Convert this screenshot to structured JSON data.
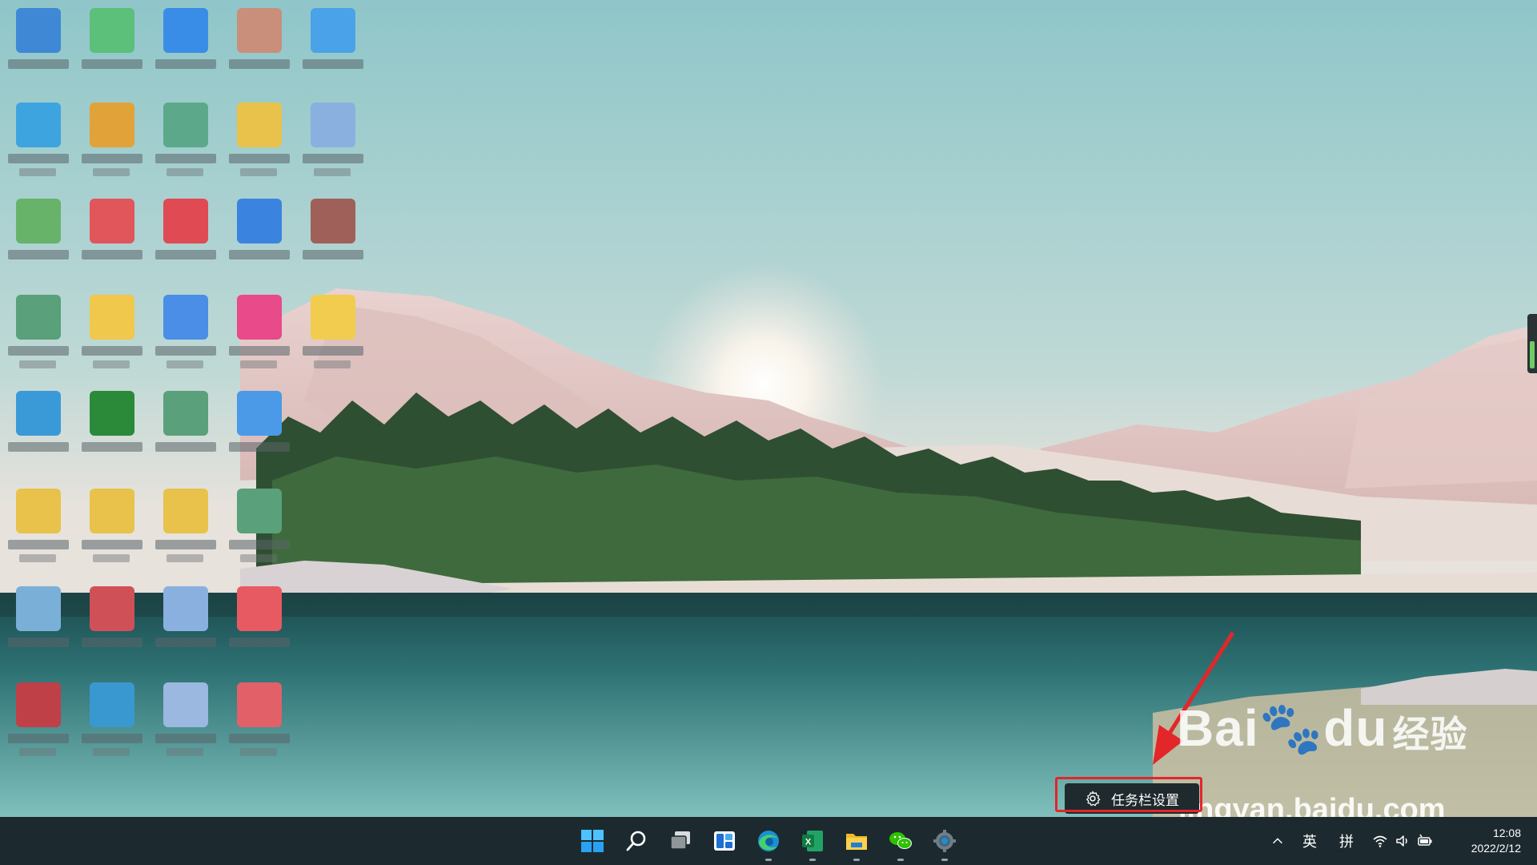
{
  "desktop": {
    "icons": [
      {
        "color": "#3f88d6"
      },
      {
        "color": "#5cbf7a"
      },
      {
        "color": "#3a8de6"
      },
      {
        "color": "#c98f7a"
      },
      {
        "color": "#4aa3e8"
      },
      {
        "color": "#3ea4e0"
      },
      {
        "color": "#e2a23a"
      },
      {
        "color": "#5ba98a"
      },
      {
        "color": "#e8c24a"
      },
      {
        "color": "#8ab0e0"
      },
      {
        "color": "#67b36a"
      },
      {
        "color": "#e0565a"
      },
      {
        "color": "#e04a52"
      },
      {
        "color": "#3a84e0"
      },
      {
        "color": "#a0605a"
      },
      {
        "color": "#5aa07a"
      },
      {
        "color": "#f0c84c"
      },
      {
        "color": "#4a8ee8"
      },
      {
        "color": "#e84a8a"
      },
      {
        "color": "#f2cc4e"
      },
      {
        "color": "#3a9ad8"
      },
      {
        "color": "#2a8a3a"
      },
      {
        "color": "#5aa07a"
      },
      {
        "color": "#4a9ae8"
      },
      {
        "color": "#e8c24a"
      },
      {
        "color": "#e8c24a"
      },
      {
        "color": "#e8c24a"
      },
      {
        "color": "#5aa07a"
      },
      {
        "color": "#7ab0d8"
      },
      {
        "color": "#d05058"
      },
      {
        "color": "#8ab0e0"
      },
      {
        "color": "#e85a62"
      },
      {
        "color": "#c04048"
      },
      {
        "color": "#3a98d0"
      },
      {
        "color": "#9ab8e0"
      },
      {
        "color": "#e26068"
      }
    ]
  },
  "context_menu": {
    "label": "任务栏设置"
  },
  "watermark": {
    "brand": "Bai",
    "brand_suffix": "du",
    "jingyan": "经验",
    "url": "jingyan.baidu.com"
  },
  "taskbar": {
    "apps": [
      {
        "name": "start-button",
        "label": "Start"
      },
      {
        "name": "search-button",
        "label": "Search"
      },
      {
        "name": "task-view-button",
        "label": "Task View"
      },
      {
        "name": "widgets-button",
        "label": "Widgets"
      },
      {
        "name": "edge-button",
        "label": "Microsoft Edge"
      },
      {
        "name": "excel-button",
        "label": "Excel"
      },
      {
        "name": "file-explorer-button",
        "label": "File Explorer"
      },
      {
        "name": "wechat-button",
        "label": "WeChat"
      },
      {
        "name": "settings-button",
        "label": "Settings"
      }
    ],
    "tray": {
      "chevron": "^",
      "lang": "英",
      "ime": "拼",
      "time": "12:08",
      "date": "2022/2/12"
    }
  },
  "colors": {
    "taskbar_bg": "#1c2a2f",
    "highlight": "#e3262a",
    "accent_blue": "#0a78d7"
  }
}
